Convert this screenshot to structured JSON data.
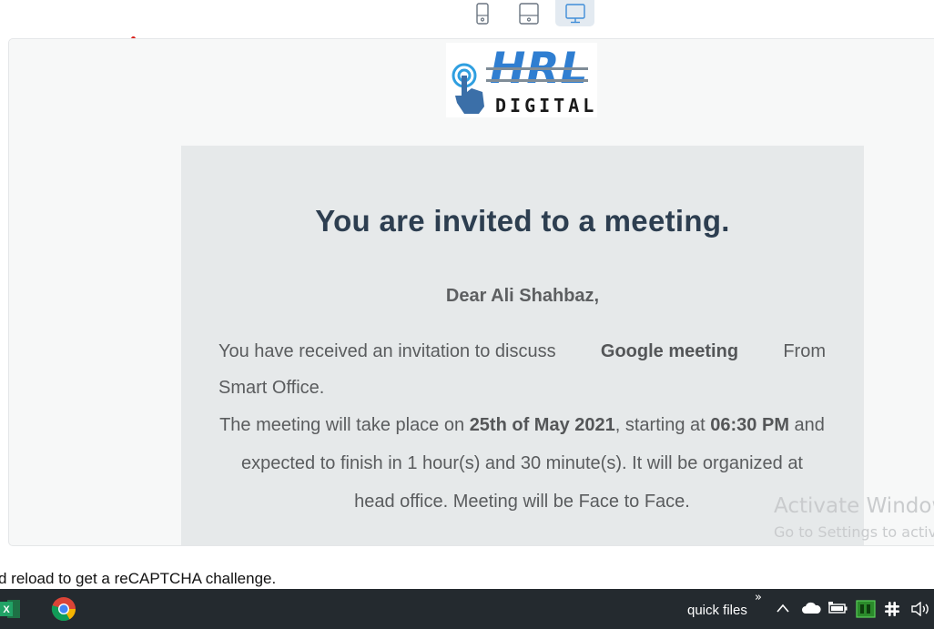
{
  "device_toggle": {
    "icons": [
      "phone-icon",
      "tablet-icon",
      "desktop-icon"
    ],
    "active": "desktop-icon"
  },
  "email": {
    "logo": {
      "top": "HRL",
      "bottom": "DIGITAL"
    },
    "title": "You are invited to a meeting.",
    "greeting": "Dear Ali Shahbaz,",
    "p1_a": "You have received an invitation to discuss",
    "p1_bold": "Google meeting",
    "p1_b": "From",
    "p1_c": "Smart Office.",
    "p2_a": "The meeting will take place on",
    "p2_date": "25th of May 2021",
    "p2_b": ", starting at",
    "p2_time": "06:30 PM",
    "p2_c": "and expected to finish in 1 hour(s) and 30 minute(s). It will be organized at head office. Meeting will be Face to Face."
  },
  "watermark": {
    "line1": "Activate Window",
    "line2": "Go to Settings to activ"
  },
  "recaptcha_text": "d reload to get a reCAPTCHA challenge.",
  "taskbar": {
    "apps": [
      "excel-icon",
      "chrome-icon"
    ],
    "quick_files": "quick files",
    "chevrons": "»",
    "tray_icons": [
      "chevron-up-icon",
      "onedrive-icon",
      "battery-icon",
      "app-tray-icon",
      "slack-icon",
      "volume-icon"
    ]
  },
  "colors": {
    "title": "#2d3e50",
    "card_bg": "#e6e9ea",
    "accent": "#2f7ed1",
    "taskbar": "#242a2f"
  }
}
